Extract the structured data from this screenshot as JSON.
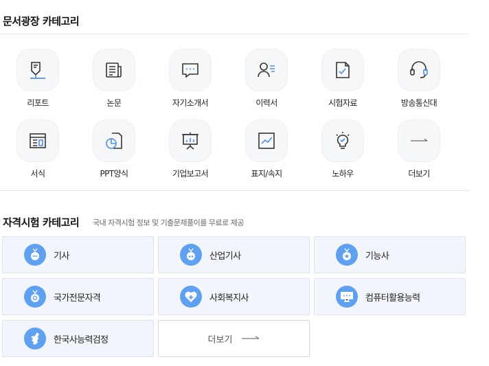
{
  "doc_section": {
    "title": "문서광장 카테고리",
    "items": [
      {
        "label": "리포트",
        "icon": "report-pen-icon"
      },
      {
        "label": "논문",
        "icon": "newspaper-icon"
      },
      {
        "label": "자기소개서",
        "icon": "speech-bubble-icon"
      },
      {
        "label": "이력서",
        "icon": "person-list-icon"
      },
      {
        "label": "시험자료",
        "icon": "exam-doc-icon"
      },
      {
        "label": "방송통신대",
        "icon": "headset-icon"
      },
      {
        "label": "서식",
        "icon": "form-layout-icon"
      },
      {
        "label": "PPT양식",
        "icon": "pie-doc-icon"
      },
      {
        "label": "기업보고서",
        "icon": "presentation-board-icon"
      },
      {
        "label": "표지/속지",
        "icon": "picture-chart-icon"
      },
      {
        "label": "노하우",
        "icon": "lightbulb-icon"
      },
      {
        "label": "더보기",
        "icon": "arrow-right-icon"
      }
    ]
  },
  "exam_section": {
    "title": "자격시험 카테고리",
    "subtitle": "국내 자격시험 정보 및 기출문제풀이를 무료로 제공",
    "items": [
      {
        "label": "기사",
        "icon": "medal-dots-icon"
      },
      {
        "label": "산업기사",
        "icon": "medal-stars-icon"
      },
      {
        "label": "기능사",
        "icon": "medal-star-icon"
      },
      {
        "label": "국가전문자격",
        "icon": "medal-ring-icon"
      },
      {
        "label": "사회복지사",
        "icon": "heart-plus-icon"
      },
      {
        "label": "컴퓨터활용능력",
        "icon": "monitor-icon"
      },
      {
        "label": "한국사능력검정",
        "icon": "korea-map-icon"
      }
    ],
    "more_label": "더보기"
  },
  "colors": {
    "accent": "#5ea1f2",
    "exam_bg": "#f2f6fc",
    "icon_stroke": "#333333"
  }
}
